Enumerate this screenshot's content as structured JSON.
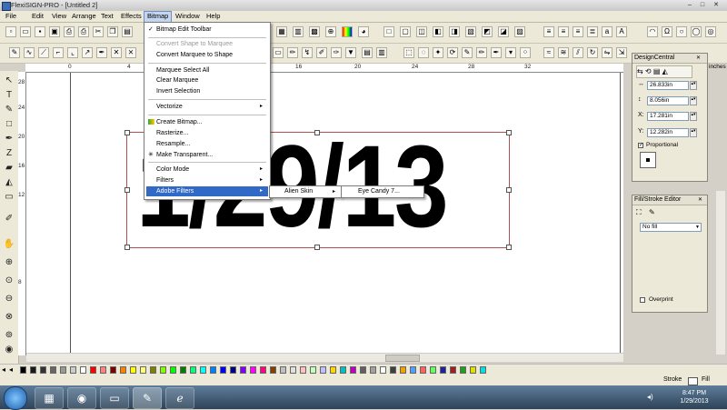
{
  "window": {
    "title": "FlexiSIGN-PRO - [Untitled 2]",
    "min": "–",
    "max": "□",
    "close": "✕"
  },
  "menubar": [
    "File",
    "Edit",
    "View",
    "Arrange",
    "Text",
    "Effects",
    "Bitmap",
    "Window",
    "Help"
  ],
  "bitmap_menu": {
    "items": [
      {
        "label": "Bitmap Edit Toolbar",
        "checked": true
      },
      {
        "label": "Convert Shape to Marquee",
        "disabled": true
      },
      {
        "label": "Convert Marquee to Shape"
      },
      {
        "label": "Marquee Select All"
      },
      {
        "label": "Clear Marquee"
      },
      {
        "label": "Invert Selection"
      },
      {
        "label": "Vectorize",
        "submenu": true
      },
      {
        "label": "Create Bitmap..."
      },
      {
        "label": "Rasterize..."
      },
      {
        "label": "Resample..."
      },
      {
        "label": "Make Transparent..."
      },
      {
        "label": "Color Mode",
        "submenu": true
      },
      {
        "label": "Filters",
        "submenu": true
      },
      {
        "label": "Adobe Filters",
        "submenu": true
      }
    ],
    "check_mark": "✓",
    "submenu_arrow": "▸"
  },
  "submenus": {
    "alien_skin": "Alien Skin",
    "eye_candy": "Eye Candy 7..."
  },
  "canvas": {
    "text": "1/29/13"
  },
  "ruler": {
    "top": [
      "0",
      "4",
      "16",
      "20",
      "24",
      "28",
      "32"
    ],
    "left": [
      "28",
      "24",
      "20",
      "16",
      "12",
      "8"
    ],
    "units": "inches"
  },
  "design_central": {
    "title": "DesignCentral",
    "width": "26.833in",
    "height": "8.056in",
    "x_label": "X:",
    "x": "17.281in",
    "y_label": "Y:",
    "y": "12.282in",
    "proportional": "Proportional"
  },
  "fill_stroke": {
    "title": "Fill/Stroke Editor",
    "fill_select": "No fill",
    "overprint": "Overprint"
  },
  "status": {
    "stroke": "Stroke",
    "fill": "Fill"
  },
  "clock": {
    "time": "8:47 PM",
    "date": "1/29/2013"
  },
  "palette": [
    "#000000",
    "#1a1a1a",
    "#333333",
    "#666666",
    "#999999",
    "#cccccc",
    "#ffffff",
    "#ff0000",
    "#ff8080",
    "#800000",
    "#ff8000",
    "#ffff00",
    "#ffff80",
    "#808000",
    "#80ff00",
    "#00ff00",
    "#008000",
    "#00ff80",
    "#00ffff",
    "#0080ff",
    "#0000ff",
    "#000080",
    "#8000ff",
    "#ff00ff",
    "#ff0080",
    "#804000",
    "#c0c0c0",
    "#e0e0e0",
    "#ffc0c0",
    "#c0ffc0",
    "#c0c0ff",
    "#ffd700",
    "#00c0c0",
    "#c000c0",
    "#606060",
    "#a0a0a0",
    "#ffffff",
    "#404040",
    "#f0a000",
    "#50a0ff",
    "#ff6060",
    "#60ff60",
    "#2020a0",
    "#a02020",
    "#20a020",
    "#e0e000",
    "#00e0e0"
  ],
  "colors": {
    "selection": "#b05050",
    "highlight": "#3169c6"
  }
}
